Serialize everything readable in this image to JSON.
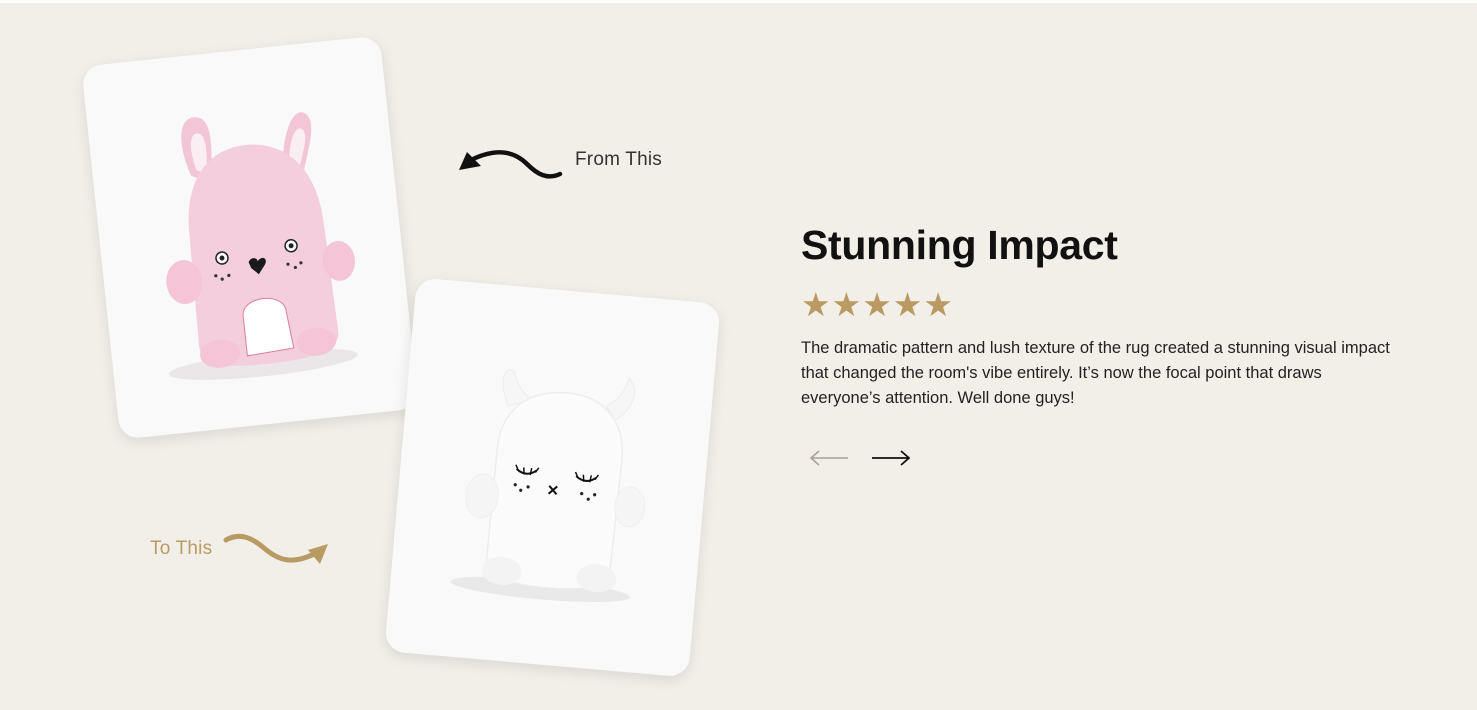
{
  "annotations": {
    "from_label": "From This",
    "to_label": "To This",
    "from_arrow_icon": "curvy-arrow-left-icon",
    "to_arrow_icon": "curvy-arrow-right-icon"
  },
  "cards": {
    "before_image": "pink-bunny-nightlight",
    "after_image": "white-monster-nightlight"
  },
  "testimonial": {
    "title": "Stunning Impact",
    "rating": 5,
    "rating_max": 5,
    "star_icon": "star-icon",
    "quote": "The dramatic pattern and lush texture of the rug created a stunning visual impact that changed the room's vibe entirely. It’s now the focal point that draws everyone’s attention. Well done guys!"
  },
  "nav": {
    "prev_icon": "arrow-left-icon",
    "next_icon": "arrow-right-icon"
  },
  "colors": {
    "background": "#f2efe9",
    "accent": "#b99a62",
    "text": "#111111",
    "card": "#f9f9f9"
  }
}
